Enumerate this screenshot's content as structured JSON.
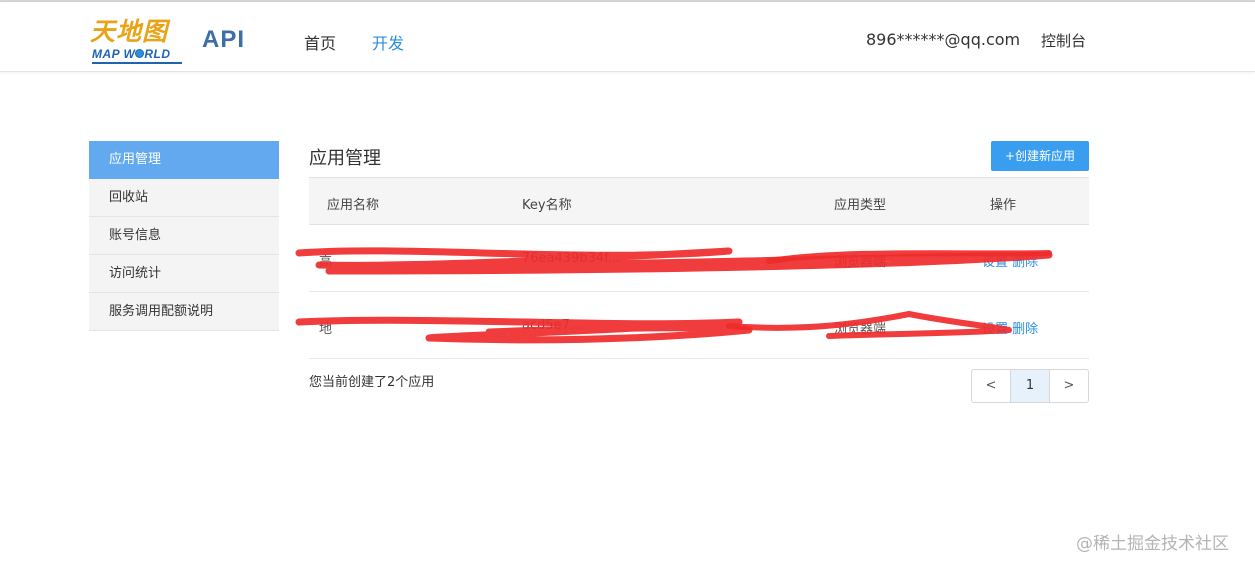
{
  "header": {
    "logo_cn": "天地图",
    "logo_en_prefix": "MAP W",
    "logo_en_suffix": "RLD",
    "api_label": "API",
    "nav": [
      {
        "label": "首页",
        "active": false
      },
      {
        "label": "开发",
        "active": true
      }
    ],
    "user_email": "896******@qq.com",
    "console_label": "控制台"
  },
  "sidebar": {
    "items": [
      {
        "label": "应用管理",
        "active": true
      },
      {
        "label": "回收站",
        "active": false
      },
      {
        "label": "账号信息",
        "active": false
      },
      {
        "label": "访问统计",
        "active": false
      },
      {
        "label": "服务调用配额说明",
        "active": false
      }
    ]
  },
  "main": {
    "title": "应用管理",
    "create_button": "+创建新应用",
    "table": {
      "headers": [
        "应用名称",
        "Key名称",
        "应用类型",
        "操作"
      ],
      "rows": [
        {
          "name": "高",
          "key": "76ea439b34f...",
          "type": "浏览器端",
          "actions": "设置 删除"
        },
        {
          "name": "地",
          "key": "acd5e7...",
          "type": "浏览器端",
          "actions": "设置 删除"
        }
      ]
    },
    "summary": "您当前创建了2个应用",
    "pagination": {
      "prev": "<",
      "current": "1",
      "next": ">"
    }
  },
  "colors": {
    "accent": "#3a9ef0",
    "sidebar_active": "#63a9ef",
    "redaction": "#ef2b2b"
  },
  "watermark": "@稀土掘金技术社区"
}
